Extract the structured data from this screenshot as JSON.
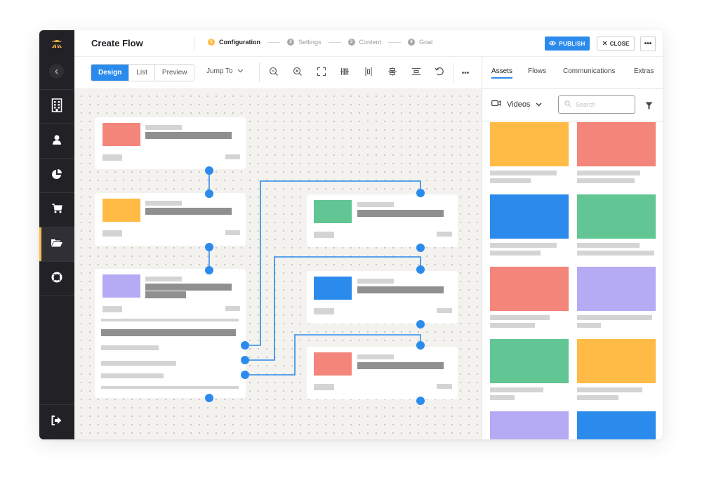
{
  "app": {
    "title": "Create Flow",
    "steps": [
      {
        "num": "1",
        "label": "Configuration",
        "active": true
      },
      {
        "num": "2",
        "label": "Settings",
        "active": false
      },
      {
        "num": "3",
        "label": "Content",
        "active": false
      },
      {
        "num": "4",
        "label": "Goal",
        "active": false
      }
    ],
    "publish_label": "PUBLISH",
    "close_label": "CLOSE",
    "more_label": "•••"
  },
  "sidebar": {
    "logo_icon": "propeller-hat-icon",
    "collapse_icon": "chevron-left-icon",
    "items": [
      {
        "icon": "building-icon",
        "active": false
      },
      {
        "icon": "user-icon",
        "active": false
      },
      {
        "icon": "pie-chart-icon",
        "active": false
      },
      {
        "icon": "cart-icon",
        "active": false
      },
      {
        "icon": "folder-open-icon",
        "active": true
      },
      {
        "icon": "lifebuoy-icon",
        "active": false
      }
    ],
    "bottom_icon": "logout-icon"
  },
  "toolbar": {
    "views": [
      {
        "label": "Design",
        "active": true
      },
      {
        "label": "List",
        "active": false
      },
      {
        "label": "Preview",
        "active": false
      }
    ],
    "jump_to_label": "Jump To",
    "tools": [
      "zoom-out-icon",
      "zoom-in-icon",
      "fit-screen-icon",
      "distribute-horizontal-icon",
      "align-center-vertical-icon",
      "align-center-horizontal-icon",
      "distribute-vertical-icon",
      "undo-icon"
    ],
    "more_label": "•••"
  },
  "canvas": {
    "nodes": [
      {
        "id": "n1",
        "color": "#f4857a"
      },
      {
        "id": "n2",
        "color": "#ffbb45"
      },
      {
        "id": "n3",
        "color": "#b5abf5"
      },
      {
        "id": "n4",
        "color": "#61c693"
      },
      {
        "id": "n5",
        "color": "#2b8bec"
      },
      {
        "id": "n6",
        "color": "#f4857a"
      }
    ],
    "connector_color": "#2b8bec"
  },
  "panel": {
    "tabs": [
      {
        "label": "Assets",
        "active": true
      },
      {
        "label": "Flows",
        "active": false
      },
      {
        "label": "Communications",
        "active": false
      },
      {
        "label": "Extras",
        "active": false
      }
    ],
    "category_label": "Videos",
    "search_placeholder": "Search",
    "assets": [
      {
        "color": "#ffbb45"
      },
      {
        "color": "#f4857a"
      },
      {
        "color": "#2b8bec"
      },
      {
        "color": "#61c693"
      },
      {
        "color": "#f4857a"
      },
      {
        "color": "#b5abf5"
      },
      {
        "color": "#61c693"
      },
      {
        "color": "#ffbb45"
      },
      {
        "color": "#b5abf5"
      },
      {
        "color": "#2b8bec"
      }
    ]
  }
}
